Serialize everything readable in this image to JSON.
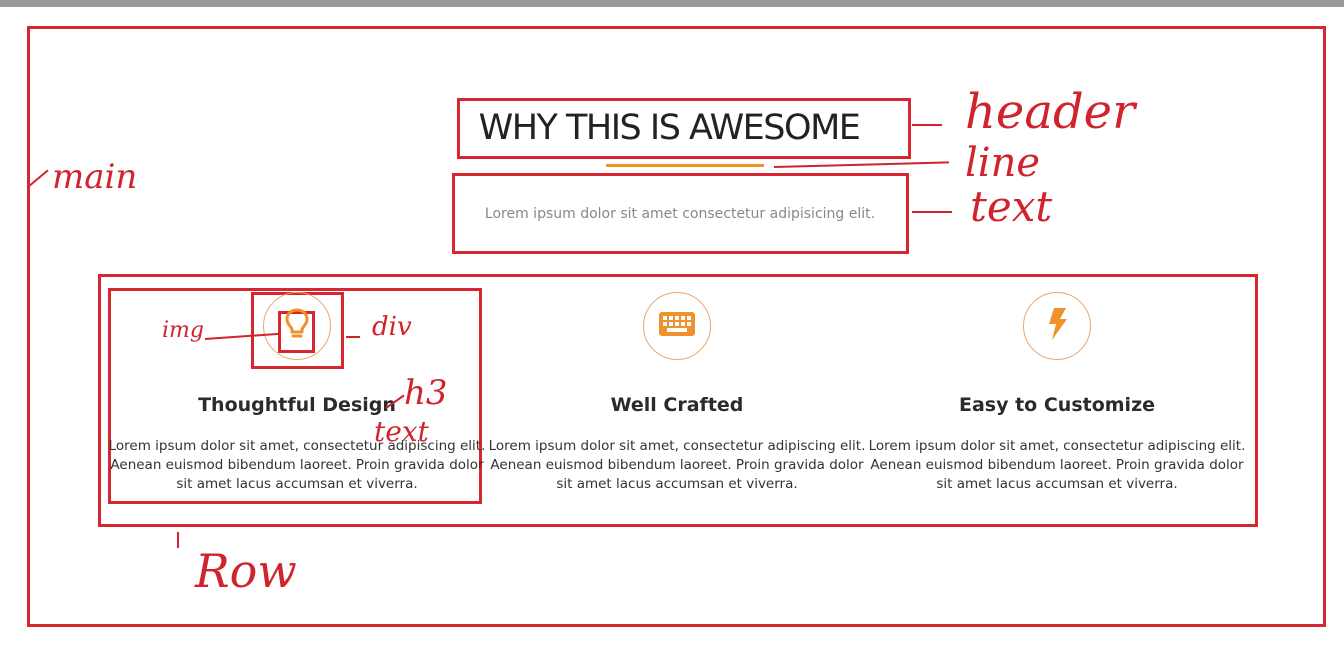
{
  "section": {
    "title": "WHY THIS IS AWESOME",
    "subtitle": "Lorem ipsum dolor sit amet consectetur adipisicing elit."
  },
  "features": [
    {
      "icon": "lightbulb-icon",
      "title": "Thoughtful Design",
      "text": "Lorem ipsum dolor sit amet, consectetur adipiscing elit. Aenean euismod bibendum laoreet. Proin gravida dolor sit amet lacus accumsan et viverra."
    },
    {
      "icon": "keyboard-icon",
      "title": "Well Crafted",
      "text": "Lorem ipsum dolor sit amet, consectetur adipiscing elit. Aenean euismod bibendum laoreet. Proin gravida dolor sit amet lacus accumsan et viverra."
    },
    {
      "icon": "lightning-bolt-icon",
      "title": "Easy to Customize",
      "text": "Lorem ipsum dolor sit amet, consectetur adipiscing elit. Aenean euismod bibendum laoreet. Proin gravida dolor sit amet lacus accumsan et viverra."
    }
  ],
  "annotations": {
    "header": "header",
    "line": "line",
    "text": "text",
    "main": "main",
    "img": "img",
    "div": "div",
    "h3": "h3",
    "feature_text": "text",
    "row": "Row"
  },
  "colors": {
    "accent": "#f0922b",
    "annotation": "#d7262f",
    "heading": "#222222",
    "muted": "#888888"
  }
}
